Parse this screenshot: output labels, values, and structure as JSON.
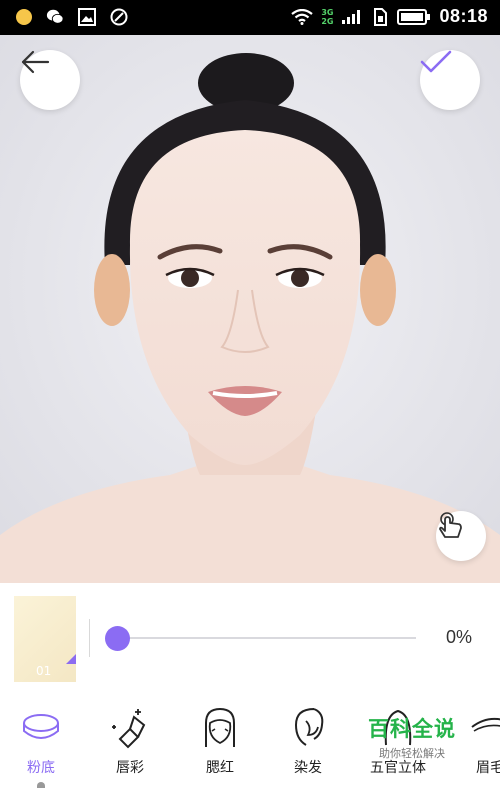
{
  "status_bar": {
    "time": "08:18",
    "network_top": "3G",
    "network_bottom": "2G",
    "icons": [
      "notification-dot-icon",
      "wechat-icon",
      "gallery-icon",
      "unknown-app-icon",
      "wifi-icon",
      "signal-icon",
      "sim-icon",
      "battery-icon"
    ]
  },
  "header": {
    "back_icon": "arrow-left-icon",
    "confirm_icon": "checkmark-icon"
  },
  "photo": {
    "gesture_icon": "hand-touch-icon"
  },
  "adjust": {
    "swatch_number": "01",
    "slider_value_fraction": 0,
    "percent_label": "0%"
  },
  "tools": [
    {
      "label": "粉底",
      "icon": "foundation-icon",
      "active": true
    },
    {
      "label": "唇彩",
      "icon": "lipstick-icon",
      "active": false
    },
    {
      "label": "腮红",
      "icon": "blush-icon",
      "active": false
    },
    {
      "label": "染发",
      "icon": "hair-dye-icon",
      "active": false
    },
    {
      "label": "五官立体",
      "icon": "contour-icon",
      "active": false
    },
    {
      "label": "眉毛",
      "icon": "eyebrow-icon",
      "active": false
    }
  ],
  "watermark": {
    "title": "百科全说",
    "subtitle": "助你轻松解决"
  },
  "colors": {
    "accent": "#8b6cf3",
    "status_bar": "#000000",
    "photo_bg": "#e7e7ec",
    "watermark_green": "#25b34a"
  }
}
